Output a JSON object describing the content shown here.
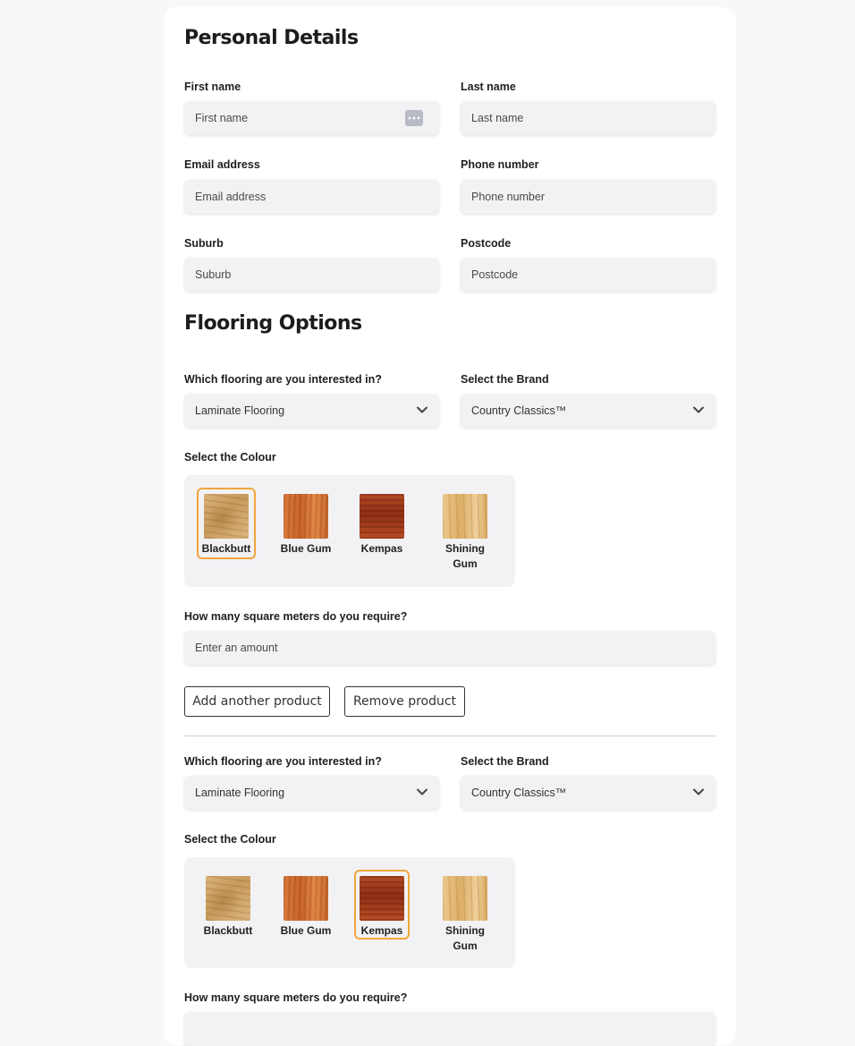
{
  "personal": {
    "title": "Personal Details",
    "first_name": {
      "label": "First name",
      "placeholder": "First name"
    },
    "last_name": {
      "label": "Last name",
      "placeholder": "Last name"
    },
    "email": {
      "label": "Email address",
      "placeholder": "Email address"
    },
    "phone": {
      "label": "Phone number",
      "placeholder": "Phone number"
    },
    "suburb": {
      "label": "Suburb",
      "placeholder": "Suburb"
    },
    "postcode": {
      "label": "Postcode",
      "placeholder": "Postcode"
    }
  },
  "flooring": {
    "title": "Flooring Options",
    "products": [
      {
        "type_label": "Which flooring are you interested in?",
        "type_value": "Laminate Flooring",
        "brand_label": "Select the Brand",
        "brand_value": "Country Classics™",
        "colour_label": "Select the Colour",
        "selected_colour": "Blackbutt",
        "colours": [
          "Blackbutt",
          "Blue Gum",
          "Kempas",
          "Shining Gum"
        ],
        "sqm_label": "How many square meters do you require?",
        "sqm_placeholder": "Enter an amount",
        "add_button": "Add another product",
        "remove_button": "Remove product"
      },
      {
        "type_label": "Which flooring are you interested in?",
        "type_value": "Laminate Flooring",
        "brand_label": "Select the Brand",
        "brand_value": "Country Classics™",
        "colour_label": "Select the Colour",
        "selected_colour": "Kempas",
        "colours": [
          "Blackbutt",
          "Blue Gum",
          "Kempas",
          "Shining Gum"
        ],
        "sqm_label": "How many square meters do you require?"
      }
    ]
  },
  "icons": {
    "password_manager": "more-dots-icon",
    "dropdown": "chevron-down-icon"
  },
  "colors": {
    "selected_border": "#f0a53c",
    "field_bg": "#f2f2f4",
    "page_bg": "#f8f8f8"
  }
}
